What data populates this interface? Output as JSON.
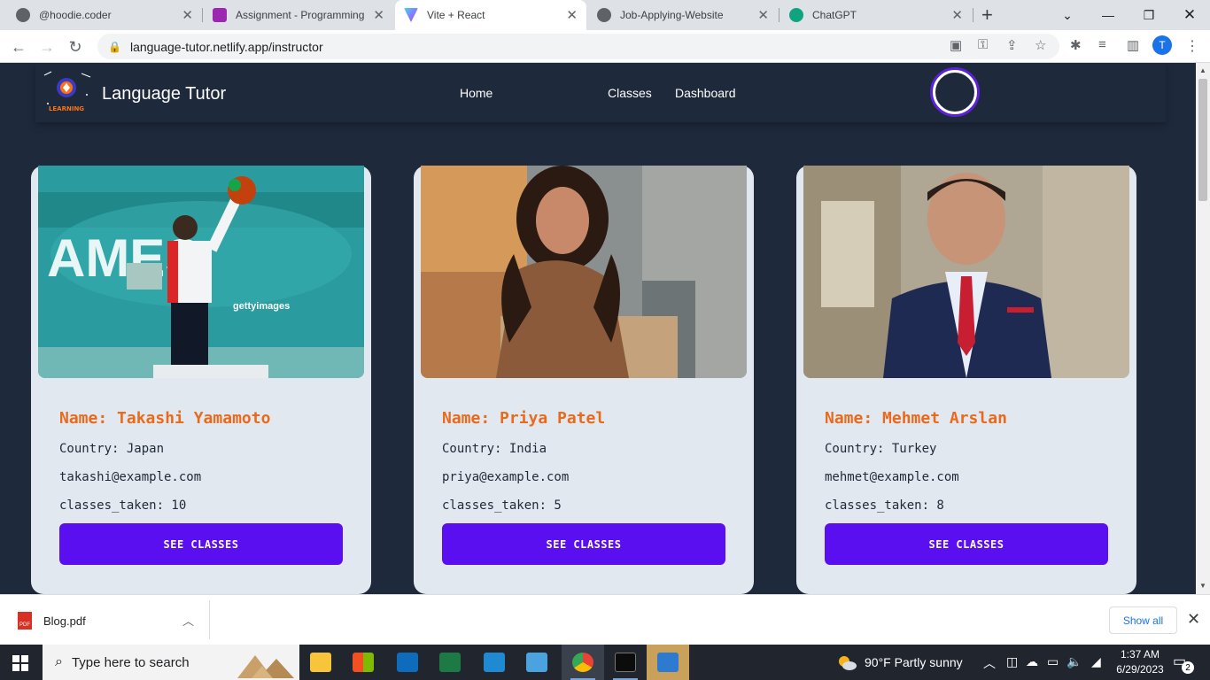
{
  "browser": {
    "tabs": [
      {
        "title": "@hoodie.coder",
        "favicon_color": "#5f6368"
      },
      {
        "title": "Assignment - Programming H",
        "favicon_color": "#9c27b0"
      },
      {
        "title": "Vite + React",
        "favicon_color": "#a855f7",
        "active": true
      },
      {
        "title": "Job-Applying-Website",
        "favicon_color": "#5f6368"
      },
      {
        "title": "ChatGPT",
        "favicon_color": "#10a37f"
      }
    ],
    "url": "language-tutor.netlify.app/instructor",
    "profile_initial": "T"
  },
  "site": {
    "brand": "Language Tutor",
    "logo_text": "LEARNING",
    "nav": {
      "home": "Home",
      "classes": "Classes",
      "dashboard": "Dashboard"
    },
    "accent_color": "#5a0ff0",
    "name_color": "#ea6a1c"
  },
  "instructors": [
    {
      "name": "Name: Takashi Yamamoto",
      "country": "Country: Japan",
      "email": "takashi@example.com",
      "classes": "classes_taken: 10",
      "button": "SEE CLASSES",
      "photo_watermark": "gettyimages",
      "photo_banner": "AMES"
    },
    {
      "name": "Name: Priya Patel",
      "country": "Country: India",
      "email": "priya@example.com",
      "classes": "classes_taken: 5",
      "button": "SEE CLASSES"
    },
    {
      "name": "Name: Mehmet Arslan",
      "country": "Country: Turkey",
      "email": "mehmet@example.com",
      "classes": "classes_taken: 8",
      "button": "SEE CLASSES"
    }
  ],
  "downloads": {
    "file": "Blog.pdf",
    "show_all": "Show all"
  },
  "taskbar": {
    "search_placeholder": "Type here to search",
    "weather": "90°F  Partly sunny",
    "time": "1:37 AM",
    "date": "6/29/2023",
    "notifications": "2"
  }
}
